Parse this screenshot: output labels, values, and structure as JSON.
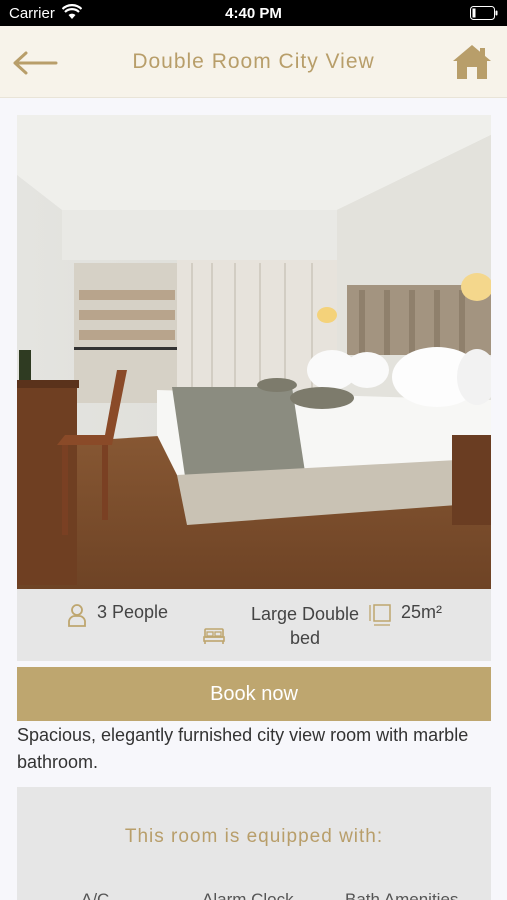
{
  "status_bar": {
    "carrier": "Carrier",
    "time": "4:40 PM"
  },
  "header": {
    "title": "Double Room City View",
    "back_icon": "arrow-left-icon",
    "home_icon": "home-icon",
    "accent_color": "#b89e6a"
  },
  "room": {
    "photo_alt": "",
    "people": "3 People",
    "bed": "Large Double bed",
    "size": "25m²"
  },
  "actions": {
    "book_label": "Book now",
    "book_color": "#bea66f"
  },
  "description": " Spacious, elegantly furnished city view room with marble bathroom.",
  "equipment": {
    "heading": "This room is equipped with:",
    "items": [
      "A/C",
      "Alarm Clock",
      "Bath Amenities"
    ]
  }
}
